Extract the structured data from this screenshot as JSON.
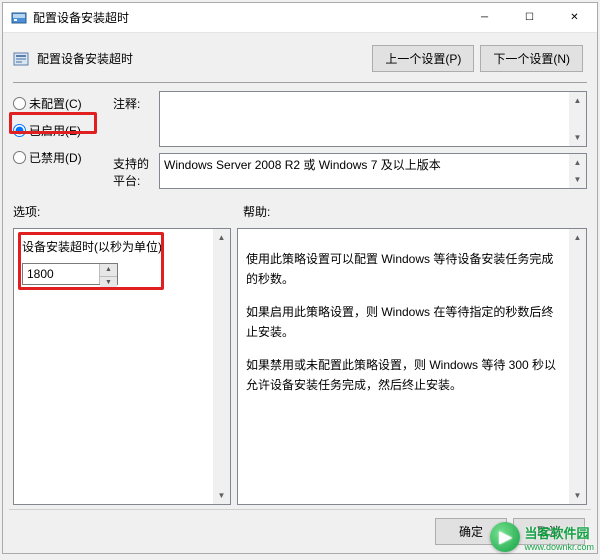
{
  "window": {
    "title": "配置设备安装超时"
  },
  "header": {
    "title": "配置设备安装超时",
    "prev_btn": "上一个设置(P)",
    "next_btn": "下一个设置(N)"
  },
  "radios": {
    "not_configured": "未配置(C)",
    "enabled": "已启用(E)",
    "disabled": "已禁用(D)",
    "selected": "enabled"
  },
  "labels": {
    "comment": "注释:",
    "supported": "支持的平台:",
    "options": "选项:",
    "help": "帮助:"
  },
  "fields": {
    "comment_text": "",
    "supported_text": "Windows Server 2008 R2 或 Windows 7 及以上版本"
  },
  "options": {
    "timeout_label": "设备安装超时(以秒为单位)",
    "timeout_value": "1800"
  },
  "help": {
    "p1": "使用此策略设置可以配置 Windows 等待设备安装任务完成的秒数。",
    "p2": "如果启用此策略设置，则 Windows 在等待指定的秒数后终止安装。",
    "p3": "如果禁用或未配置此策略设置，则 Windows 等待 300 秒以允许设备安装任务完成，然后终止安装。"
  },
  "footer": {
    "ok": "确定",
    "cancel": "取消"
  },
  "watermark": {
    "site": "当客软件园",
    "url": "www.downkr.com"
  }
}
